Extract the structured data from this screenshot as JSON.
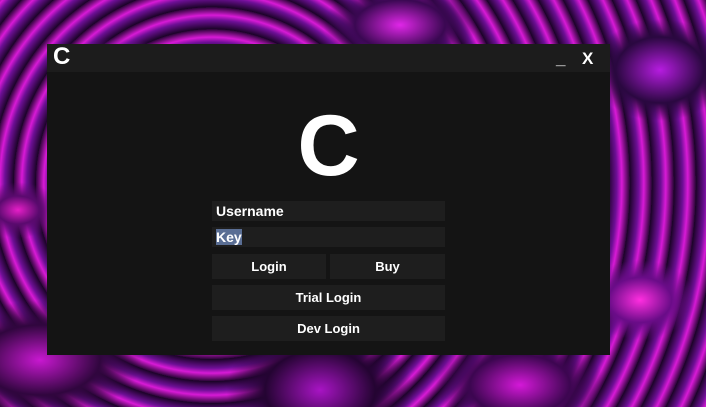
{
  "window": {
    "title_logo": "C",
    "minimize_label": "_",
    "close_label": "X"
  },
  "logo": {
    "text": "C"
  },
  "form": {
    "username_value": "Username",
    "key_value": "Key"
  },
  "buttons": {
    "login": "Login",
    "buy": "Buy",
    "trial_login": "Trial Login",
    "dev_login": "Dev Login"
  },
  "colors": {
    "window_bg": "#141414",
    "titlebar_bg": "#1c1c1c",
    "control_bg": "#1e1e1e",
    "text": "#ffffff",
    "selection": "#5a6e94"
  }
}
